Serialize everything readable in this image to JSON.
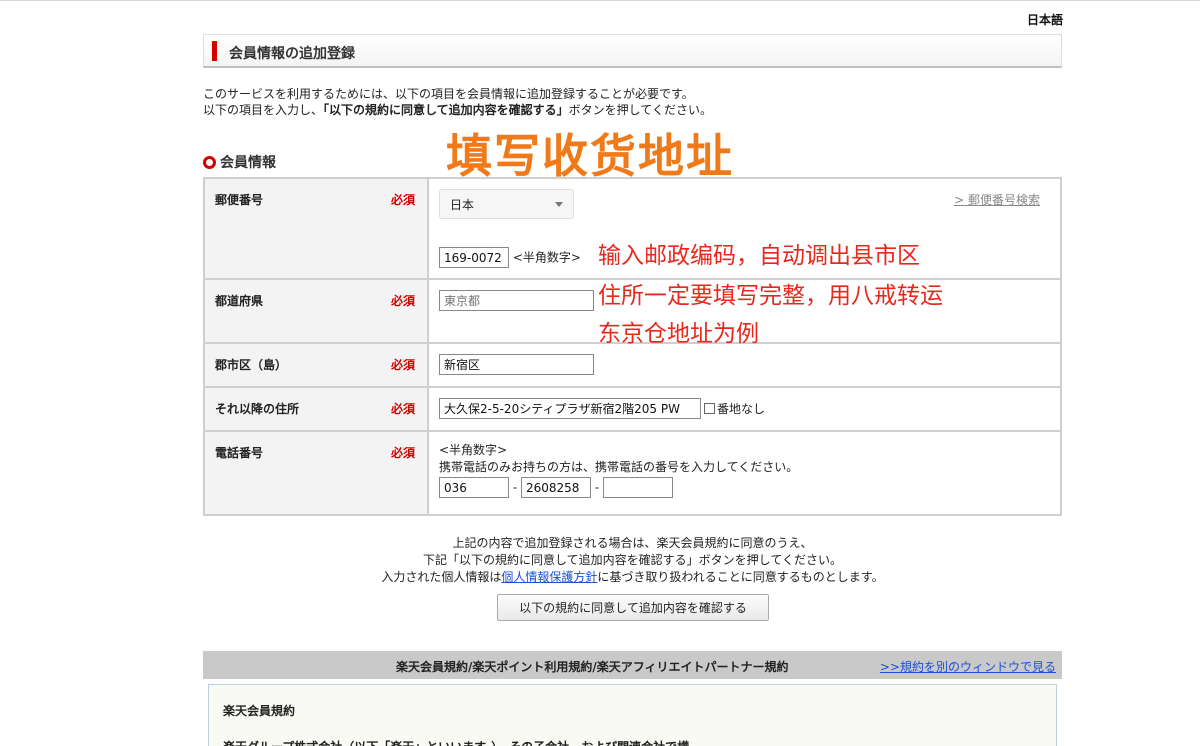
{
  "language": "日本語",
  "header": {
    "title": "会員情報の追加登録"
  },
  "intro": {
    "line1": "このサービスを利用するためには、以下の項目を会員情報に追加登録することが必要です。",
    "line2_pre": "以下の項目を入力し、",
    "line2_bold": "「以下の規約に同意して追加内容を確認する」",
    "line2_post": "ボタンを押してください。"
  },
  "section_title": "会員情報",
  "annotations": {
    "title": "填写收货地址",
    "line1": "输入邮政编码，自动调出县市区",
    "line2": "住所一定要填写完整，用八戒转运",
    "line3": "东京仓地址为例"
  },
  "required_label": "必須",
  "form": {
    "postal": {
      "label": "郵便番号",
      "country": "日本",
      "value": "169-0072",
      "hint": "<半角数字>",
      "search_link": "> 郵便番号検索"
    },
    "prefecture": {
      "label": "都道府県",
      "placeholder": "東京都"
    },
    "city": {
      "label": "郡市区（島）",
      "value": "新宿区"
    },
    "address": {
      "label": "それ以降の住所",
      "value": "大久保2-5-20シティプラザ新宿2階205 PW",
      "no_number_label": "番地なし"
    },
    "phone": {
      "label": "電話番号",
      "hint": "<半角数字>",
      "note": "携帯電話のみお持ちの方は、携帯電話の番号を入力してください。",
      "part1": "036",
      "part2": "2608258",
      "part3": "",
      "sep": "-"
    }
  },
  "notice": {
    "line1": "上記の内容で追加登録される場合は、楽天会員規約に同意のうえ、",
    "line2": "下記「以下の規約に同意して追加内容を確認する」ボタンを押してください。",
    "line3_pre": "入力された個人情報は",
    "line3_link": "個人情報保護方針",
    "line3_post": "に基づき取り扱われることに同意するものとします。"
  },
  "submit_label": "以下の規約に同意して追加内容を確認する",
  "terms": {
    "bar_title": "楽天会員規約/楽天ポイント利用規約/楽天アフィリエイトパートナー規約",
    "open_link": ">>規約を別のウィンドウで見る",
    "heading": "楽天会員規約",
    "first_line": "楽天グループ株式会社（以下「楽天」といいます。）、その子会社、および関連会社で構"
  }
}
